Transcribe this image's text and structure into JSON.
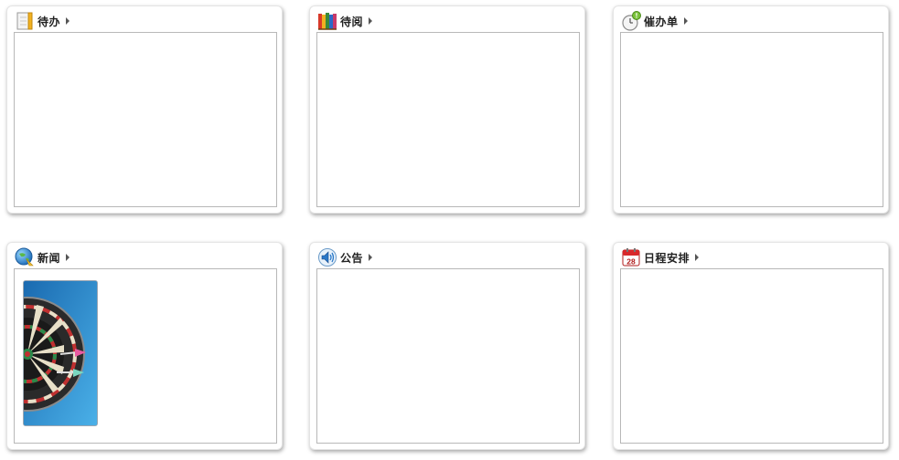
{
  "panels": [
    {
      "id": "todo",
      "title": "待办",
      "icon": "notebook-icon"
    },
    {
      "id": "toread",
      "title": "待阅",
      "icon": "books-icon"
    },
    {
      "id": "urge",
      "title": "催办单",
      "icon": "clock-alert-icon"
    },
    {
      "id": "news",
      "title": "新闻",
      "icon": "globe-icon",
      "image": "dartboard-image"
    },
    {
      "id": "notice",
      "title": "公告",
      "icon": "speaker-icon"
    },
    {
      "id": "schedule",
      "title": "日程安排",
      "icon": "calendar-icon",
      "icon_text": "28"
    }
  ],
  "colors": {
    "panel_border": "#e4e4e4",
    "content_border": "#b8b8b8",
    "title_text": "#222222",
    "calendar_red": "#d8282b",
    "image_blue": "#2a87c8"
  }
}
